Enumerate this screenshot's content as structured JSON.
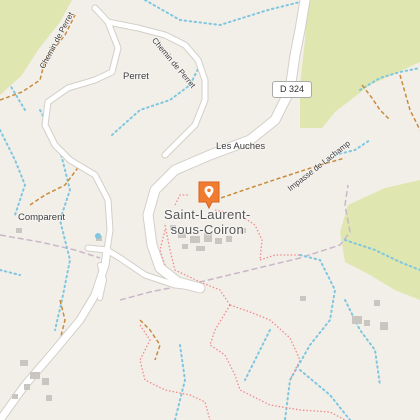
{
  "map": {
    "places": {
      "perret": "Perret",
      "les_auches": "Les Auches",
      "comparent": "Comparent",
      "village_line1": "Saint-Laurent-",
      "village_line2": "sous-Coiron"
    },
    "roads": {
      "chemin_perret_1": "Chemin de Perret",
      "chemin_perret_2": "Chemin de Perret",
      "impasse": "Impasse de Lachamp",
      "route_number": "D 324"
    },
    "marker": {
      "icon": "map-pin-icon",
      "color": "#f07c32"
    },
    "colors": {
      "land": "#f2efe9",
      "grass": "#dfe6b0",
      "water": "#7fc6e0",
      "road": "#ffffff",
      "track": "#c98a3c",
      "footpath": "#f08a8a",
      "boundary": "#c9b7c9"
    }
  }
}
